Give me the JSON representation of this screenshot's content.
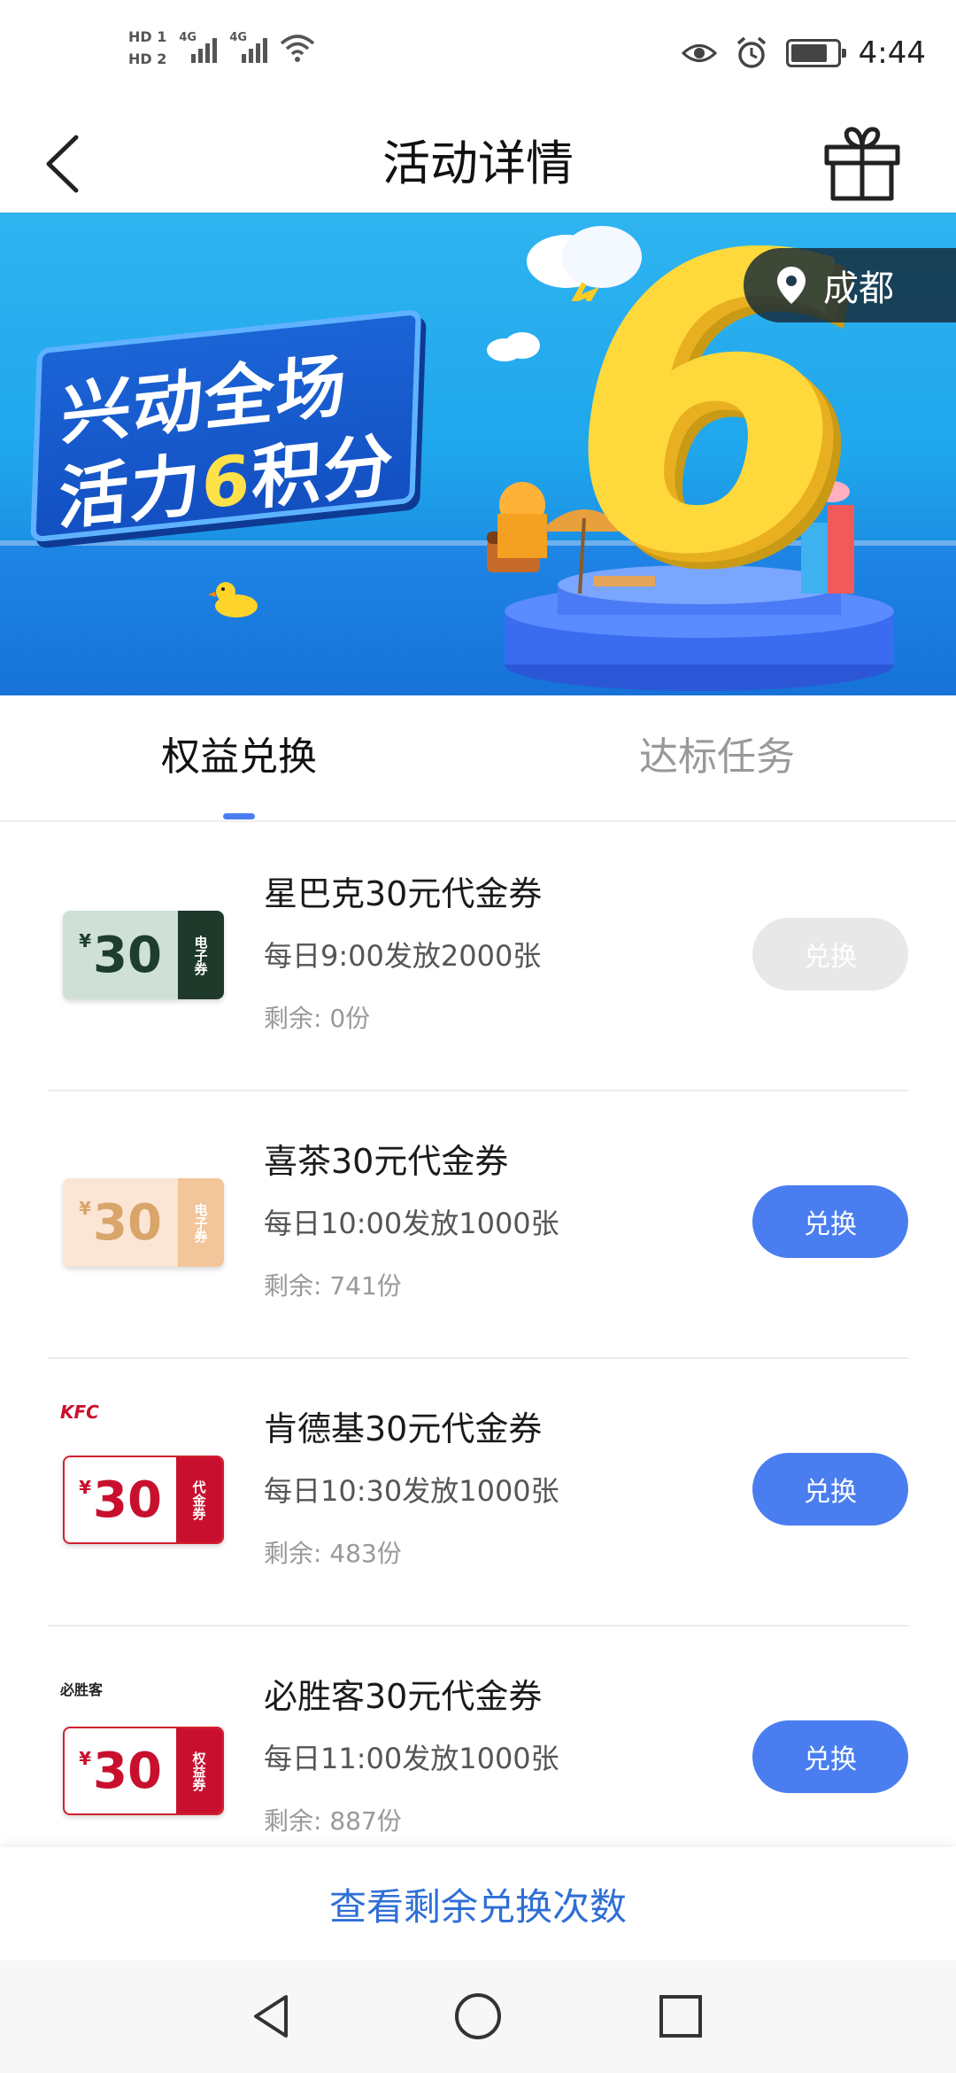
{
  "status_bar": {
    "sim1": "HD 1",
    "sim2": "HD 2",
    "net1": "4G",
    "net2": "4G",
    "time": "4:44",
    "battery_level": 0.8
  },
  "header": {
    "title": "活动详情",
    "back_icon": "back-arrow-icon",
    "gift_icon": "gift-icon"
  },
  "banner": {
    "slogan_line1": "兴动全场",
    "slogan_line2_a": "活力",
    "slogan_line2_num": "6",
    "slogan_line2_b": "积分",
    "big_number": "6",
    "location": "成都"
  },
  "tabs": [
    {
      "label": "权益兑换",
      "active": true
    },
    {
      "label": "达标任务",
      "active": false
    }
  ],
  "items": [
    {
      "title": "星巴克30元代金券",
      "schedule": "每日9:00发放2000张",
      "remaining": "剩余: 0份",
      "button": "兑换",
      "enabled": false,
      "coupon": {
        "currency": "¥",
        "amount": "30",
        "side": "电子券",
        "brand": ""
      }
    },
    {
      "title": "喜茶30元代金券",
      "schedule": "每日10:00发放1000张",
      "remaining": "剩余: 741份",
      "button": "兑换",
      "enabled": true,
      "coupon": {
        "currency": "¥",
        "amount": "30",
        "side": "电子券",
        "brand": ""
      }
    },
    {
      "title": "肯德基30元代金券",
      "schedule": "每日10:30发放1000张",
      "remaining": "剩余: 483份",
      "button": "兑换",
      "enabled": true,
      "coupon": {
        "currency": "¥",
        "amount": "30",
        "side": "代金券",
        "brand": "KFC"
      }
    },
    {
      "title": "必胜客30元代金券",
      "schedule": "每日11:00发放1000张",
      "remaining": "剩余: 887份",
      "button": "兑换",
      "enabled": true,
      "coupon": {
        "currency": "¥",
        "amount": "30",
        "side": "权益券",
        "brand": "必胜客"
      }
    }
  ],
  "footer": {
    "link": "查看剩余兑换次数"
  },
  "colors": {
    "accent": "#4a7ef0",
    "link": "#2f6fd6",
    "disabled_button": "#e8e8e8",
    "banner_sky": "#2fb4f0",
    "banner_sea": "#1672d8"
  }
}
